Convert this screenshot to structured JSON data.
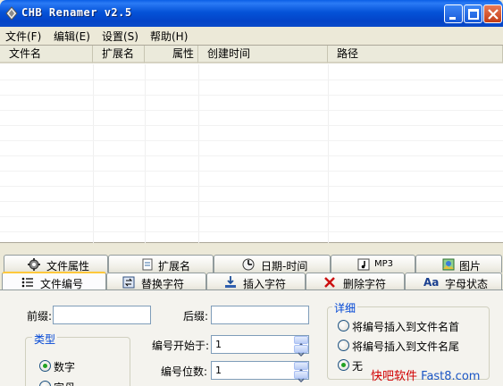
{
  "window": {
    "title": "CHB Renamer v2.5"
  },
  "menu": [
    {
      "label": "文件(F)"
    },
    {
      "label": "编辑(E)"
    },
    {
      "label": "设置(S)"
    },
    {
      "label": "帮助(H)"
    }
  ],
  "file_list": {
    "columns": [
      "文件名",
      "扩展名",
      "属性",
      "创建时间",
      "路径"
    ],
    "rows": []
  },
  "tabs_row1": [
    {
      "label": "文件属性",
      "icon": "gear-icon"
    },
    {
      "label": "扩展名",
      "icon": "document-icon"
    },
    {
      "label": "日期-时间",
      "icon": "clock-icon"
    },
    {
      "label": "MP3",
      "icon": "music-icon"
    },
    {
      "label": "图片",
      "icon": "image-icon"
    }
  ],
  "tabs_row2": [
    {
      "label": "文件编号",
      "icon": "numbered-list-icon",
      "active": true
    },
    {
      "label": "替换字符",
      "icon": "replace-icon"
    },
    {
      "label": "插入字符",
      "icon": "insert-icon"
    },
    {
      "label": "删除字符",
      "icon": "delete-x-icon"
    },
    {
      "label": "字母状态",
      "icon": "letter-case-icon",
      "icon_text": "Aa"
    }
  ],
  "numbering": {
    "prefix_label": "前缀:",
    "prefix_value": "",
    "suffix_label": "后缀:",
    "suffix_value": "",
    "type_group_title": "类型",
    "type_options": [
      "数字",
      "字母"
    ],
    "type_selected": "数字",
    "start_label": "编号开始于:",
    "start_value": "1",
    "digits_label": "编号位数:",
    "digits_value": "1",
    "detail_group_title": "详细",
    "detail_options": [
      "将编号插入到文件名首",
      "将编号插入到文件名尾",
      "无"
    ],
    "detail_selected": "无"
  },
  "watermark": {
    "part1": "快吧软件",
    "part2": "Fast8.com"
  },
  "colors": {
    "titlebar": "#0553D8",
    "tab_active_accent": "#FFC83C",
    "group_title": "#0046D5"
  }
}
